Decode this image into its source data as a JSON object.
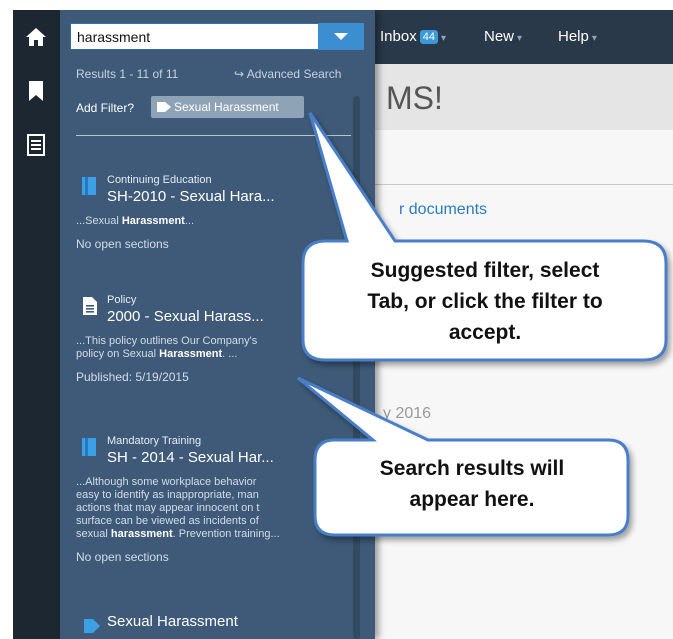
{
  "nav": {
    "inbox_label": "Inbox",
    "inbox_count": "44",
    "new_label": "New",
    "help_label": "Help"
  },
  "main": {
    "welcome_fragment": "MS!",
    "docs_link_fragment": "r documents",
    "date_fragment": "y 2016"
  },
  "search": {
    "value": "harassment",
    "results_count": "Results 1 - 11 of 11",
    "advanced_search": "Advanced Search",
    "add_filter_label": "Add Filter?",
    "filter_chip": "Sexual Harassment"
  },
  "results": [
    {
      "category": "Continuing Education",
      "title": "SH-2010 - Sexual Hara...",
      "snippet_pre": "...Sexual ",
      "snippet_bold": "Harassment",
      "snippet_post": "...",
      "meta": "No open sections",
      "icon": "book-icon"
    },
    {
      "category": "Policy",
      "title": "2000 - Sexual Harass...",
      "snippet_line1": "...This policy outlines Our Company's",
      "snippet_pre": "policy on Sexual ",
      "snippet_bold": "Harassment",
      "snippet_post": ". ...",
      "meta": "Published: 5/19/2015",
      "icon": "document-icon"
    },
    {
      "category": "Mandatory Training",
      "title": "SH - 2014 - Sexual Har...",
      "snippet_lines": [
        "...Although some workplace behavior",
        "easy to identify as inappropriate, man",
        "actions that may appear innocent on t",
        "surface can be viewed as incidents of"
      ],
      "snippet_pre": "sexual ",
      "snippet_bold": "harassment",
      "snippet_post": ". Prevention training...",
      "meta": "No open sections",
      "icon": "book-icon"
    },
    {
      "title": "Sexual Harassment",
      "icon": "tag-icon"
    }
  ],
  "callouts": {
    "filter_tip": [
      "Suggested filter, select",
      "Tab, or click the filter to",
      "accept."
    ],
    "results_tip": [
      "Search results will",
      "appear here."
    ]
  },
  "colors": {
    "rail": "#1d2731",
    "topnav": "#2a3949",
    "panel": "#3e5a78",
    "accent": "#3b8fd1",
    "callout_border": "#4a7fc9"
  }
}
